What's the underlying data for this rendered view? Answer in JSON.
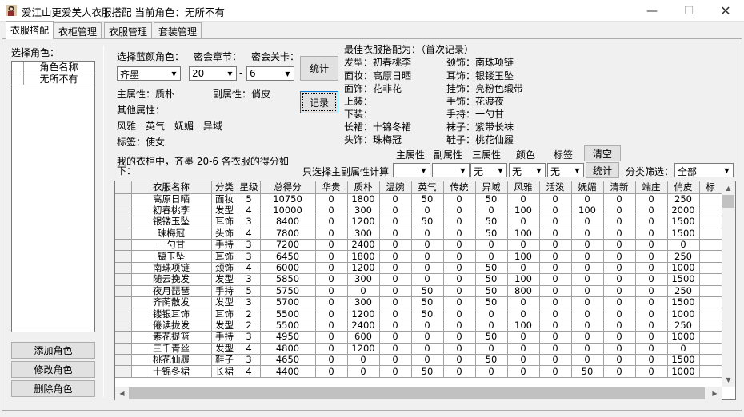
{
  "window": {
    "title": "爱江山更爱美人衣服搭配  当前角色：无所不有",
    "minimize": "—",
    "maximize": "☐",
    "close": "✕"
  },
  "tabs": [
    "衣服搭配",
    "衣柜管理",
    "衣服管理",
    "套装管理"
  ],
  "left": {
    "select_role_label": "选择角色：",
    "role_list_header": "角色名称",
    "roles": [
      "无所不有"
    ],
    "add_button": "添加角色",
    "edit_button": "修改角色",
    "delete_button": "删除角色"
  },
  "selectors": {
    "role_label": "选择蓝颜角色：",
    "chapter_label": "密会章节：",
    "level_label": "密会关卡：",
    "role_value": "齐墨",
    "chapter_value": "20",
    "dash": "-",
    "level_value": "6",
    "stats_button": "统计",
    "record_button": "记录"
  },
  "attributes": {
    "main_attr": "主属性：质朴",
    "sub_attr": "副属性：俏皮",
    "other_label": "其他属性：",
    "other_values": [
      "风雅",
      "英气",
      "妩媚",
      "异域"
    ],
    "tag": "标签：使女"
  },
  "best": {
    "header": "最佳衣服搭配为：（首次记录）",
    "left_items": [
      "发型：初春桃李",
      "面妆：高原日晒",
      "面饰：花非花",
      "上装：",
      "下装：",
      "长裙：十锦冬裙",
      "头饰：珠梅冠"
    ],
    "right_items": [
      "颈饰：南珠项链",
      "耳饰：银镂玉坠",
      "挂饰：亮粉色缎带",
      "手饰：花渡夜",
      "手持：一勺甘",
      "袜子：紫带长袜",
      "鞋子：桃花仙履"
    ]
  },
  "filter": {
    "score_text": "我的衣柜中，齐墨 20-6 各衣服的得分如下：",
    "only_label": "只选择主副属性计算",
    "col_main": "主属性",
    "col_sub": "副属性",
    "col_third": "三属性",
    "col_color": "颜色",
    "col_tag": "标签",
    "clear_button": "清空",
    "stats_button": "统计",
    "main_value": "",
    "sub_value": "",
    "third_value": "无",
    "color_value": "无",
    "tag_value": "无",
    "category_label": "分类筛选：",
    "category_value": "全部"
  },
  "grid": {
    "columns": [
      "衣服名称",
      "分类",
      "星级",
      "总得分",
      "华贵",
      "质朴",
      "温婉",
      "英气",
      "传统",
      "异域",
      "风雅",
      "活泼",
      "妩媚",
      "清新",
      "端庄",
      "俏皮",
      "标"
    ],
    "rows": [
      [
        "高原日晒",
        "面妆",
        "5",
        "10750",
        "0",
        "1800",
        "0",
        "50",
        "0",
        "50",
        "0",
        "0",
        "0",
        "0",
        "0",
        "250",
        ""
      ],
      [
        "初春桃李",
        "发型",
        "4",
        "10000",
        "0",
        "300",
        "0",
        "0",
        "0",
        "0",
        "100",
        "0",
        "100",
        "0",
        "0",
        "2000",
        ""
      ],
      [
        "银镂玉坠",
        "耳饰",
        "3",
        "8400",
        "0",
        "1200",
        "0",
        "50",
        "0",
        "50",
        "0",
        "0",
        "0",
        "0",
        "0",
        "1500",
        ""
      ],
      [
        "珠梅冠",
        "头饰",
        "4",
        "7800",
        "0",
        "300",
        "0",
        "0",
        "0",
        "50",
        "100",
        "0",
        "0",
        "0",
        "0",
        "1500",
        ""
      ],
      [
        "一勺甘",
        "手持",
        "3",
        "7200",
        "0",
        "2400",
        "0",
        "0",
        "0",
        "0",
        "0",
        "0",
        "0",
        "0",
        "0",
        "0",
        ""
      ],
      [
        "镐玉坠",
        "耳饰",
        "3",
        "6450",
        "0",
        "1800",
        "0",
        "0",
        "0",
        "0",
        "100",
        "0",
        "0",
        "0",
        "0",
        "250",
        ""
      ],
      [
        "南珠项链",
        "颈饰",
        "4",
        "6000",
        "0",
        "1200",
        "0",
        "0",
        "0",
        "50",
        "0",
        "0",
        "0",
        "0",
        "0",
        "1000",
        ""
      ],
      [
        "随云挽发",
        "发型",
        "3",
        "5850",
        "0",
        "300",
        "0",
        "0",
        "0",
        "50",
        "100",
        "0",
        "0",
        "0",
        "0",
        "1500",
        ""
      ],
      [
        "夜月琵琶",
        "手持",
        "5",
        "5750",
        "0",
        "0",
        "0",
        "50",
        "0",
        "50",
        "800",
        "0",
        "0",
        "0",
        "0",
        "250",
        ""
      ],
      [
        "齐荫散发",
        "发型",
        "3",
        "5700",
        "0",
        "300",
        "0",
        "50",
        "0",
        "50",
        "0",
        "0",
        "0",
        "0",
        "0",
        "1500",
        ""
      ],
      [
        "镂银耳饰",
        "耳饰",
        "2",
        "5500",
        "0",
        "1200",
        "0",
        "50",
        "0",
        "0",
        "0",
        "0",
        "0",
        "0",
        "0",
        "1000",
        ""
      ],
      [
        "倦读拢发",
        "发型",
        "2",
        "5500",
        "0",
        "2400",
        "0",
        "0",
        "0",
        "0",
        "100",
        "0",
        "0",
        "0",
        "0",
        "250",
        ""
      ],
      [
        "素花提篮",
        "手持",
        "3",
        "4950",
        "0",
        "600",
        "0",
        "0",
        "0",
        "50",
        "0",
        "0",
        "0",
        "0",
        "0",
        "1000",
        ""
      ],
      [
        "三千青丝",
        "发型",
        "4",
        "4800",
        "0",
        "1200",
        "0",
        "0",
        "0",
        "0",
        "0",
        "0",
        "0",
        "0",
        "0",
        "0",
        ""
      ],
      [
        "桃花仙履",
        "鞋子",
        "3",
        "4650",
        "0",
        "0",
        "0",
        "0",
        "0",
        "50",
        "0",
        "0",
        "0",
        "0",
        "0",
        "1500",
        ""
      ],
      [
        "十锦冬裙",
        "长裙",
        "4",
        "4400",
        "0",
        "0",
        "0",
        "50",
        "0",
        "0",
        "0",
        "0",
        "50",
        "0",
        "0",
        "1000",
        ""
      ]
    ]
  },
  "icons": {
    "app": "app-icon",
    "combo_arrow": "▼",
    "scroll_up": "▲",
    "scroll_down": "▼",
    "scroll_left": "◀",
    "scroll_right": "▶"
  }
}
